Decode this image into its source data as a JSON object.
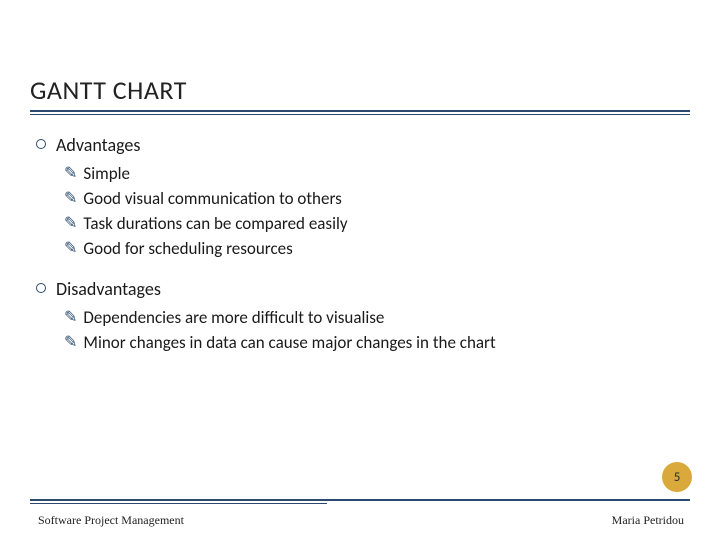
{
  "title": "GANTT CHART",
  "sections": [
    {
      "heading": "Advantages",
      "items": [
        "Simple",
        "Good visual communication to others",
        "Task durations can be compared easily",
        "Good for scheduling resources"
      ]
    },
    {
      "heading": "Disadvantages",
      "items": [
        "Dependencies are more difficult to visualise",
        "Minor changes in data can cause major changes in the chart"
      ]
    }
  ],
  "page_number": "5",
  "footer_left": "Software Project Management",
  "footer_right": "Maria Petridou"
}
